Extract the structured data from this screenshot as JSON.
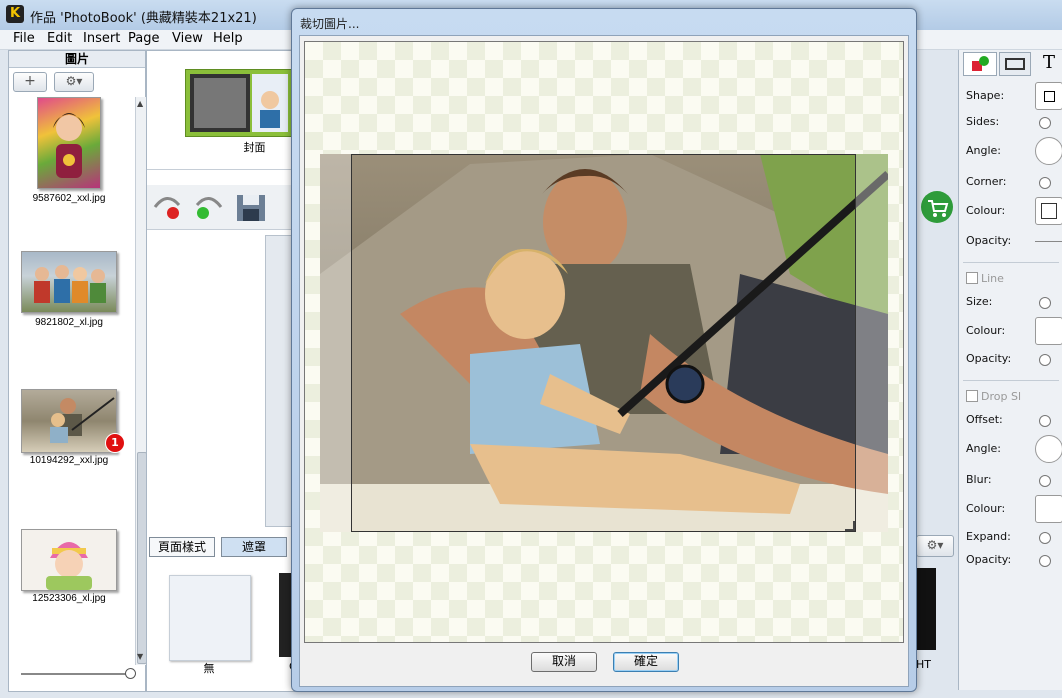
{
  "window": {
    "title": "作品 'PhotoBook' (典藏精裝本21x21)"
  },
  "menu": [
    "File",
    "Edit",
    "Insert",
    "Page",
    "View",
    "Help"
  ],
  "left_panel": {
    "header": "圖片",
    "add_button": "+",
    "gear_button": "⚙▾",
    "files": [
      {
        "name": "9587602_xxl.jpg"
      },
      {
        "name": "9821802_xl.jpg"
      },
      {
        "name": "10194292_xxl.jpg",
        "badge": "1"
      },
      {
        "name": "12523306_xl.jpg"
      }
    ]
  },
  "center_panel": {
    "cover_label": "封面",
    "tabs": [
      "頁面樣式",
      "遮罩"
    ],
    "none_label": "無",
    "partial_label": "C",
    "partial_right": "HT"
  },
  "right_panel": {
    "shape_label": "Shape:",
    "sides_label": "Sides:",
    "angle_label": "Angle:",
    "corner_label": "Corner:",
    "colour_label": "Colour:",
    "opacity_label": "Opacity:",
    "line_label": "Line",
    "size_label": "Size:",
    "line_colour_label": "Colour:",
    "line_opacity_label": "Opacity:",
    "drop_shadow_label": "Drop Sl",
    "offset_label": "Offset:",
    "shadow_angle_label": "Angle:",
    "blur_label": "Blur:",
    "shadow_colour_label": "Colour:",
    "expand_label": "Expand:",
    "shadow_opacity_label": "Opacity:",
    "text_tool_glyph": "T"
  },
  "dialog": {
    "title": "裁切圖片...",
    "cancel": "取消",
    "ok": "確定"
  },
  "colors": {
    "accent": "#3c7fb1",
    "badge": "#e01010",
    "cart": "#2e9b3a"
  }
}
